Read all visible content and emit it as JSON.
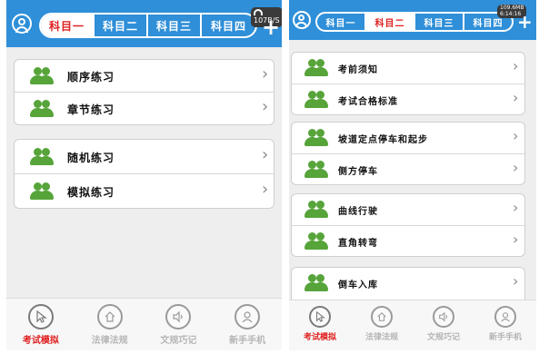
{
  "colors": {
    "brand_blue": "#2f8fd8",
    "active_red": "#e02020",
    "icon_green": "#56a43a",
    "inactive_gray": "#b5b5b5"
  },
  "left_screen": {
    "header": {
      "tabs": [
        {
          "label": "科目一",
          "active": true
        },
        {
          "label": "科目二",
          "active": false
        },
        {
          "label": "科目三",
          "active": false
        },
        {
          "label": "科目四",
          "active": false
        }
      ],
      "status": {
        "line1": "107B/S"
      },
      "plus_icon": "plus-icon",
      "avatar_icon": "user-icon"
    },
    "groups": [
      {
        "items": [
          {
            "label": "顺序练习",
            "icon": "users-icon"
          },
          {
            "label": "章节练习",
            "icon": "users-icon"
          }
        ]
      },
      {
        "items": [
          {
            "label": "随机练习",
            "icon": "users-icon"
          },
          {
            "label": "模拟练习",
            "icon": "users-icon"
          }
        ]
      }
    ],
    "bottom_nav": [
      {
        "label": "考试模拟",
        "icon": "cursor-icon",
        "active": true
      },
      {
        "label": "法律法规",
        "icon": "home-icon",
        "active": false
      },
      {
        "label": "文规巧记",
        "icon": "speaker-icon",
        "active": false
      },
      {
        "label": "新手手机",
        "icon": "user-icon",
        "active": false
      }
    ]
  },
  "right_screen": {
    "header": {
      "tabs": [
        {
          "label": "科目一",
          "active": false
        },
        {
          "label": "科目二",
          "active": true
        },
        {
          "label": "科目三",
          "active": false
        },
        {
          "label": "科目四",
          "active": false
        }
      ],
      "status": {
        "line1": "109.6MB",
        "line2": "6:14:16"
      },
      "plus_icon": "plus-icon",
      "avatar_icon": "user-icon"
    },
    "groups": [
      {
        "items": [
          {
            "label": "考前须知",
            "icon": "users-icon"
          },
          {
            "label": "考试合格标准",
            "icon": "users-icon"
          }
        ]
      },
      {
        "items": [
          {
            "label": "坡道定点停车和起步",
            "icon": "users-icon"
          },
          {
            "label": "侧方停车",
            "icon": "users-icon"
          }
        ]
      },
      {
        "items": [
          {
            "label": "曲线行驶",
            "icon": "users-icon"
          },
          {
            "label": "直角转弯",
            "icon": "users-icon"
          }
        ]
      },
      {
        "items": [
          {
            "label": "倒车入库",
            "icon": "users-icon"
          }
        ]
      }
    ],
    "bottom_nav": [
      {
        "label": "考试模拟",
        "icon": "cursor-icon",
        "active": true
      },
      {
        "label": "法律法规",
        "icon": "home-icon",
        "active": false
      },
      {
        "label": "文规巧记",
        "icon": "speaker-icon",
        "active": false
      },
      {
        "label": "新手手机",
        "icon": "user-icon",
        "active": false
      }
    ]
  }
}
